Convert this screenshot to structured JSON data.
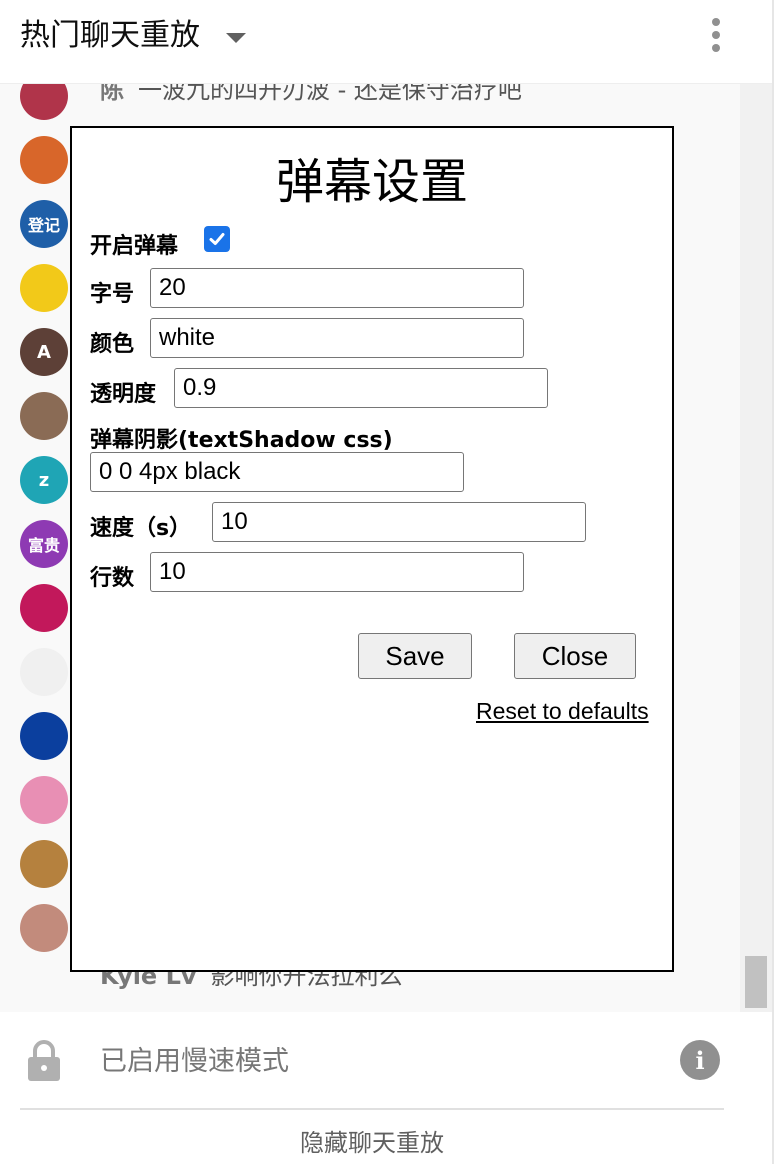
{
  "header": {
    "title": "热门聊天重放",
    "caret_icon": "dropdown-caret-icon",
    "more_icon": "more-vert-icon"
  },
  "chat": {
    "top_partial": {
      "author": "陈",
      "message": "一波九的四开刃波 - 还是保守治疗吧"
    },
    "bottom_partial": {
      "author": "Kyle Lv",
      "message": "影响你开法拉利么"
    },
    "avatars": [
      {
        "label": "",
        "color": "#b0344a"
      },
      {
        "label": "",
        "color": "#d8662a"
      },
      {
        "label": "登记",
        "color": "#1f5fa8"
      },
      {
        "label": "",
        "color": "#f2c919"
      },
      {
        "label": "A",
        "color": "#5d4037"
      },
      {
        "label": "",
        "color": "#8a6b55"
      },
      {
        "label": "z",
        "color": "#1fa5b5"
      },
      {
        "label": "富贵",
        "color": "#8e3ab3"
      },
      {
        "label": "",
        "color": "#c2185b"
      },
      {
        "label": "",
        "color": "#f0f0f0"
      },
      {
        "label": "",
        "color": "#0b3f9e"
      },
      {
        "label": "",
        "color": "#e88fb4"
      },
      {
        "label": "",
        "color": "#b5813e"
      },
      {
        "label": "",
        "color": "#c28b7c"
      }
    ]
  },
  "modal": {
    "title": "弹幕设置",
    "enable_label": "开启弹幕",
    "enable_checked": true,
    "font_size_label": "字号",
    "font_size_value": "20",
    "color_label": "颜色",
    "color_value": "white",
    "opacity_label": "透明度",
    "opacity_value": "0.9",
    "shadow_label": "弹幕阴影(textShadow css)",
    "shadow_value": "0 0 4px black",
    "speed_label": "速度（s）",
    "speed_value": "10",
    "rows_label": "行数",
    "rows_value": "10",
    "save_label": "Save",
    "close_label": "Close",
    "reset_label": "Reset to defaults"
  },
  "footer": {
    "slow_mode_text": "已启用慢速模式",
    "lock_icon": "lock-icon",
    "info_icon_glyph": "i",
    "hide_replay_label": "隐藏聊天重放"
  }
}
